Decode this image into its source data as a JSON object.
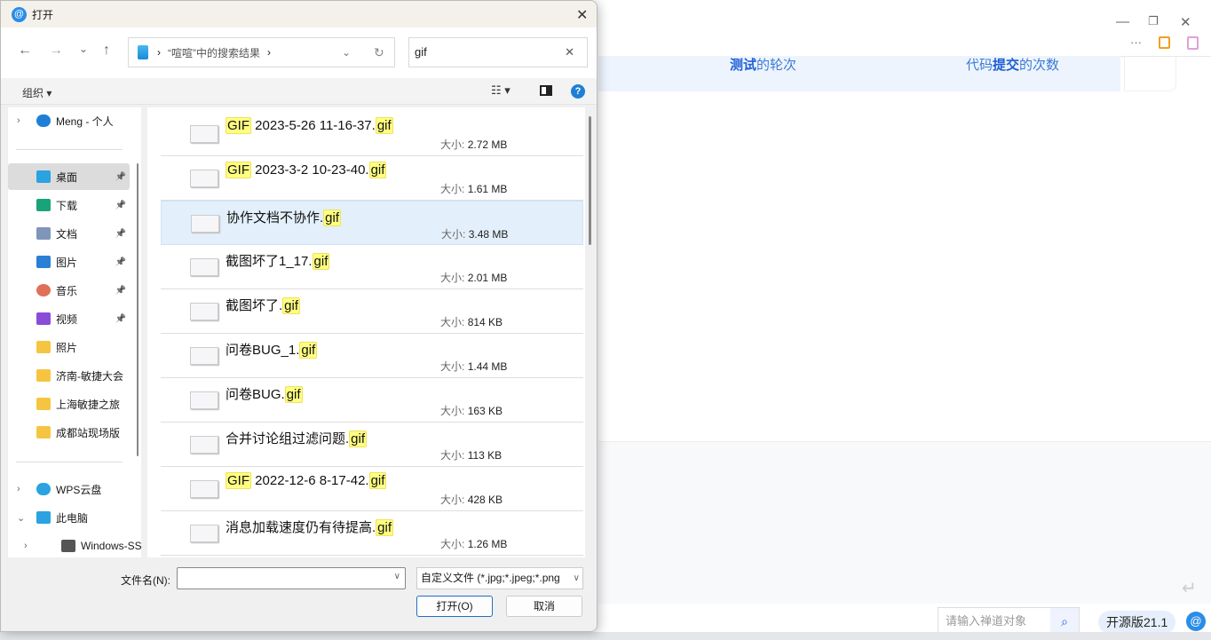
{
  "background_app": {
    "banner_left": {
      "bold": "测试",
      "rest": "的轮次"
    },
    "banner_right": {
      "pre": "代码",
      "bold": "提交",
      "rest": "的次数"
    },
    "window_controls": {
      "minimize": "—",
      "restore": "❐",
      "close": "✕"
    },
    "more_icon": "···",
    "search_placeholder": "请输入禅道对象",
    "version_badge": "开源版21.1",
    "return_icon": "↵"
  },
  "dialog": {
    "title": "打开",
    "close": "✕",
    "nav": {
      "back": "←",
      "forward": "→",
      "recent": "⌄",
      "up": "↑"
    },
    "address": {
      "path": "“喧喧”中的搜索结果",
      "chevron": "›"
    },
    "search_value": "gif",
    "toolbar": {
      "organize": "组织 ▾",
      "view": "☷ ▾",
      "help": "?"
    },
    "nav_pane": [
      {
        "label": "Meng - 个人",
        "icon": "onedrive-icon",
        "color": "#1f7fd6"
      },
      {
        "label": "桌面",
        "icon": "desktop-icon",
        "pinned": true,
        "selected": true,
        "color": "#2aa3e0"
      },
      {
        "label": "下载",
        "icon": "download-icon",
        "pinned": true,
        "color": "#19a37a"
      },
      {
        "label": "文档",
        "icon": "document-icon",
        "pinned": true,
        "color": "#7f96b8"
      },
      {
        "label": "图片",
        "icon": "pictures-icon",
        "pinned": true,
        "color": "#2a7fd6"
      },
      {
        "label": "音乐",
        "icon": "music-icon",
        "pinned": true,
        "color": "#e0705a"
      },
      {
        "label": "视频",
        "icon": "video-icon",
        "pinned": true,
        "color": "#8a4bd8"
      },
      {
        "label": "照片",
        "icon": "folder-icon",
        "color": "#f5c542"
      },
      {
        "label": "济南-敏捷大会",
        "icon": "folder-icon",
        "color": "#f5c542"
      },
      {
        "label": "上海敏捷之旅",
        "icon": "folder-icon",
        "color": "#f5c542"
      },
      {
        "label": "成都站现场版",
        "icon": "folder-icon",
        "color": "#f5c542"
      },
      {
        "label": "WPS云盘",
        "icon": "cloud-icon",
        "color": "#2aa3e0"
      },
      {
        "label": "此电脑",
        "icon": "computer-icon",
        "color": "#2aa3e0"
      },
      {
        "label": "Windows-SSD",
        "icon": "drive-icon",
        "color": "#555555"
      }
    ],
    "files": [
      {
        "pre_hl": "GIF",
        "name": " 2023-5-26 11-16-37.",
        "ext": "gif",
        "size_label": "大小:",
        "size": "2.72 MB"
      },
      {
        "pre_hl": "GIF",
        "name": " 2023-3-2 10-23-40.",
        "ext": "gif",
        "size_label": "大小:",
        "size": "1.61 MB"
      },
      {
        "pre_hl": "",
        "name": "协作文档不协作.",
        "ext": "gif",
        "size_label": "大小:",
        "size": "3.48 MB",
        "selected": true
      },
      {
        "pre_hl": "",
        "name": "截图坏了1_17.",
        "ext": "gif",
        "size_label": "大小:",
        "size": "2.01 MB"
      },
      {
        "pre_hl": "",
        "name": "截图坏了.",
        "ext": "gif",
        "size_label": "大小:",
        "size": "814 KB"
      },
      {
        "pre_hl": "",
        "name": "问卷BUG_1.",
        "ext": "gif",
        "size_label": "大小:",
        "size": "1.44 MB"
      },
      {
        "pre_hl": "",
        "name": "问卷BUG.",
        "ext": "gif",
        "size_label": "大小:",
        "size": "163 KB"
      },
      {
        "pre_hl": "",
        "name": "合并讨论组过滤问题.",
        "ext": "gif",
        "size_label": "大小:",
        "size": "113 KB"
      },
      {
        "pre_hl": "GIF",
        "name": " 2022-12-6 8-17-42.",
        "ext": "gif",
        "size_label": "大小:",
        "size": "428 KB"
      },
      {
        "pre_hl": "",
        "name": "消息加载速度仍有待提高.",
        "ext": "gif",
        "size_label": "大小:",
        "size": "1.26 MB"
      }
    ],
    "footer": {
      "filename_label": "文件名(N):",
      "filename_value": "",
      "filetype": "自定义文件 (*.jpg;*.jpeg;*.png",
      "open": "打开(O)",
      "cancel": "取消"
    }
  }
}
